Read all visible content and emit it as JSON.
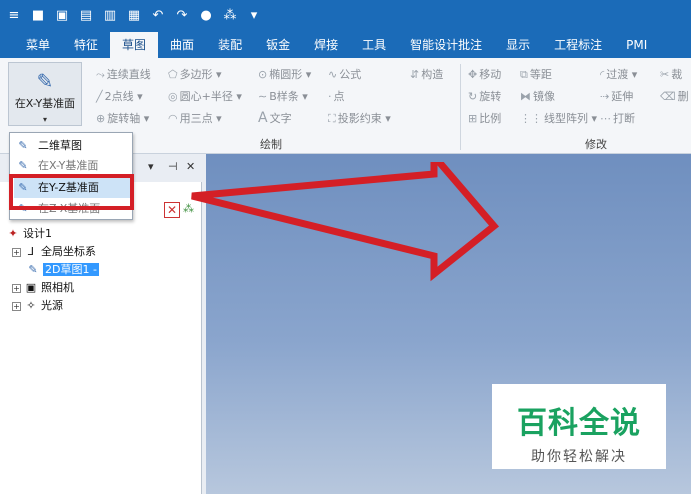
{
  "quick_access": {
    "icons": [
      "app-menu-icon",
      "new-file-icon",
      "open-icon",
      "save-icon",
      "print-icon",
      "undo-icon",
      "redo-icon",
      "settings-icon",
      "filter-icon",
      "dropdown-icon"
    ],
    "glyphs": [
      "≡",
      "■",
      "▣",
      "▤",
      "▥",
      "▦",
      "↶",
      "↷",
      "●",
      "⁂",
      "▾"
    ]
  },
  "tabs": [
    "菜单",
    "特征",
    "草图",
    "曲面",
    "装配",
    "钣金",
    "焊接",
    "工具",
    "智能设计批注",
    "显示",
    "工程标注",
    "PMI"
  ],
  "active_tab": "草图",
  "ribbon": {
    "plane_button": {
      "label": "在X-Y基准面",
      "arrow": "▾"
    },
    "draw_tools": {
      "row1": [
        "连续直线",
        "多边形",
        "椭圆形",
        "公式",
        "构造"
      ],
      "row2": [
        "2点线",
        "圆心+半径",
        "B样条",
        "点"
      ],
      "row3": [
        "旋转轴",
        "用三点",
        "文字",
        "投影约束"
      ]
    },
    "modify_tools": {
      "row1": [
        "移动",
        "等距",
        "过渡",
        "裁"
      ],
      "row2": [
        "旋转",
        "镜像",
        "延伸",
        "删"
      ],
      "row3": [
        "比例",
        "线型阵列",
        "打断"
      ]
    },
    "group_draw": "绘制",
    "group_modify": "修改"
  },
  "dropdown": {
    "items": [
      {
        "label": "二维草图",
        "icon": "sketch-icon"
      },
      {
        "label": "在X-Y基准面",
        "icon": "xy-plane-icon"
      },
      {
        "label": "在Y-Z基准面",
        "icon": "yz-plane-icon"
      },
      {
        "label": "在Z-X基准面",
        "icon": "zx-plane-icon"
      }
    ],
    "highlighted": "在Y-Z基准面"
  },
  "panel": {
    "controls": [
      "▾",
      "⊣",
      "✕"
    ]
  },
  "tree": {
    "root": "设计1",
    "items": [
      {
        "label": "全局坐标系",
        "icon": "axis-icon",
        "expandable": true
      },
      {
        "label": "2D草图1 -",
        "icon": "sketch-icon",
        "expandable": false,
        "selected": true
      },
      {
        "label": "照相机",
        "icon": "camera-icon",
        "expandable": true
      },
      {
        "label": "光源",
        "icon": "light-icon",
        "expandable": true
      }
    ]
  },
  "watermark": {
    "main": "百科全说",
    "sub": "助你轻松解决"
  },
  "colors": {
    "title_bar": "#1b6bb8",
    "highlight_box": "#d41f26",
    "watermark_green": "#1aa260",
    "selection": "#3399ff"
  }
}
